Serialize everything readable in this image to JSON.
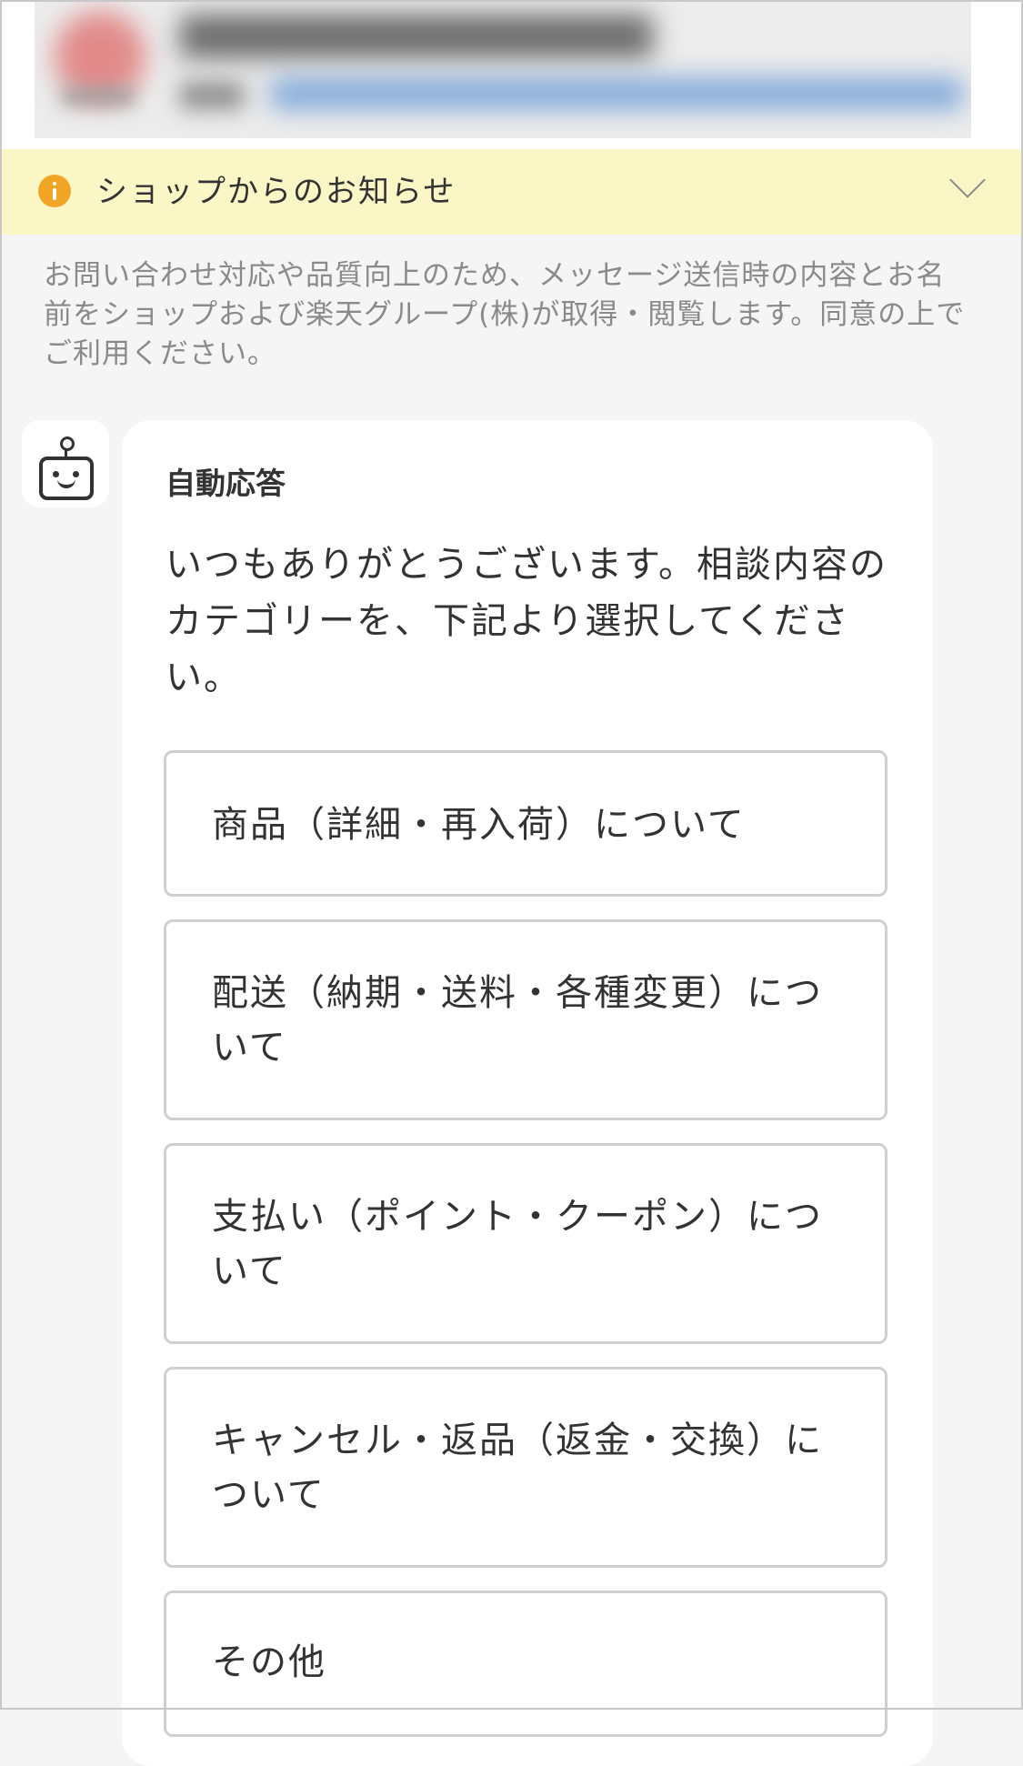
{
  "notice": {
    "title": "ショップからのお知らせ",
    "icon": "info-icon",
    "toggle_icon": "chevron-down-icon"
  },
  "privacy": {
    "text": "お問い合わせ対応や品質向上のため、メッセージ送信時の内容とお名前をショップおよび楽天グループ(株)が取得・閲覧します。同意の上でご利用ください。"
  },
  "chat": {
    "sender": "自動応答",
    "message": "いつもありがとうございます。相談内容のカテゴリーを、下記より選択してください。",
    "options": [
      {
        "label": "商品（詳細・再入荷）について"
      },
      {
        "label": "配送（納期・送料・各種変更）について"
      },
      {
        "label": "支払い（ポイント・クーポン）について"
      },
      {
        "label": "キャンセル・返品（返金・交換）について"
      },
      {
        "label": "その他"
      }
    ]
  },
  "colors": {
    "notice_background": "#fbf6c6",
    "info_icon": "#f2a524",
    "page_background": "#f5f5f5",
    "option_border": "#d0d0d0"
  }
}
